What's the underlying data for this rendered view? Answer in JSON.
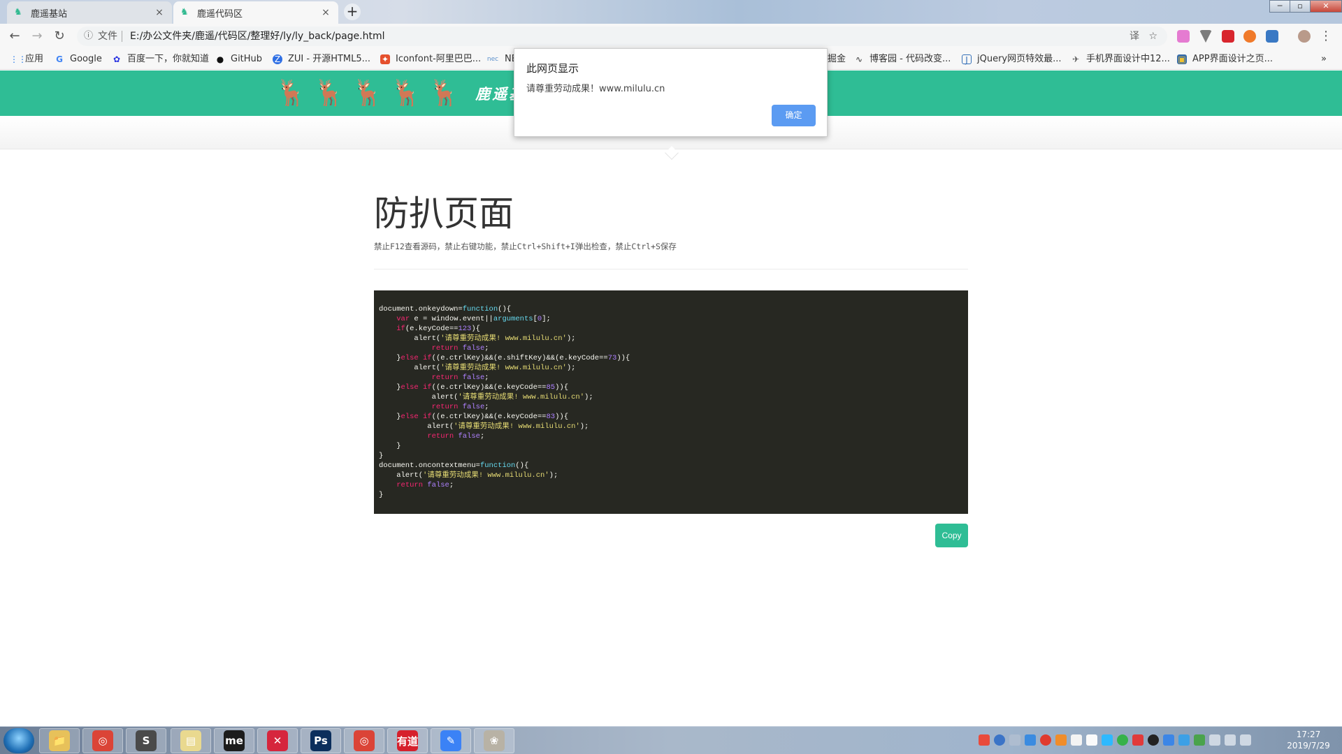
{
  "tabs": [
    {
      "title": "鹿遥基站",
      "close": "×"
    },
    {
      "title": "鹿遥代码区",
      "close": "×"
    }
  ],
  "newtab": "+",
  "window_controls": {
    "minimize": "─",
    "maximize": "▫",
    "close": "✕"
  },
  "toolbar": {
    "back": "←",
    "forward": "→",
    "reload": "↻",
    "info_icon": "ⓘ",
    "scheme": "文件",
    "url": "E:/办公文件夹/鹿遥/代码区/整理好/ly/ly_back/page.html",
    "translate": "译",
    "star": "☆"
  },
  "bookmarks": [
    {
      "label": "应用",
      "icon": "apps-icon",
      "glyph": "⋮⋮"
    },
    {
      "label": "Google",
      "icon": "google-icon",
      "glyph": "G"
    },
    {
      "label": "百度一下，你就知道",
      "icon": "baidu-icon",
      "glyph": "✿"
    },
    {
      "label": "GitHub",
      "icon": "github-icon",
      "glyph": "●"
    },
    {
      "label": "ZUI - 开源HTML5...",
      "icon": "zui-icon",
      "glyph": "Z"
    },
    {
      "label": "Iconfont-阿里巴巴...",
      "icon": "iconfont-icon",
      "glyph": "✦"
    },
    {
      "label": "NE",
      "icon": "nec-icon",
      "glyph": "nec"
    },
    {
      "label": "掘金",
      "icon": "juejin-icon",
      "glyph": ""
    },
    {
      "label": "博客园 - 代码改变...",
      "icon": "cnblogs-icon",
      "glyph": "∿"
    },
    {
      "label": "jQuery网页特效最...",
      "icon": "jquery-icon",
      "glyph": "J"
    },
    {
      "label": "手机界面设计中12...",
      "icon": "plane-icon",
      "glyph": "✈"
    },
    {
      "label": "APP界面设计之页...",
      "icon": "app-icon",
      "glyph": "▣"
    }
  ],
  "bookmarks_more": "»",
  "page": {
    "site_name": "鹿遥基站",
    "deer_glyphs": [
      "🦌",
      "🦌",
      "🦌",
      "🦌",
      "🦌"
    ],
    "subnav_label": "",
    "heading": "防扒页面",
    "description": "禁止F12查看源码，禁止右键功能，禁止Ctrl+Shift+I弹出检查，禁止Ctrl+S保存",
    "code": [
      "document.onkeydown=function(){",
      "    var e = window.event||arguments[0];",
      "    if(e.keyCode==123){",
      "        alert('请尊重劳动成果! www.milulu.cn');",
      "            return false;",
      "    }else if((e.ctrlKey)&&(e.shiftKey)&&(e.keyCode==73)){",
      "        alert('请尊重劳动成果! www.milulu.cn');",
      "            return false;",
      "    }else if((e.ctrlKey)&&(e.keyCode==85)){",
      "            alert('请尊重劳动成果! www.milulu.cn');",
      "            return false;",
      "    }else if((e.ctrlKey)&&(e.keyCode==83)){",
      "           alert('请尊重劳动成果! www.milulu.cn');",
      "           return false;",
      "    }",
      "}",
      "document.oncontextmenu=function(){",
      "    alert('请尊重劳动成果! www.milulu.cn');",
      "    return false;",
      "}"
    ],
    "copy_label": "Copy"
  },
  "dialog": {
    "title": "此网页显示",
    "message": "请尊重劳动成果！www.milulu.cn",
    "ok_label": "确定"
  },
  "taskbar": {
    "apps": [
      {
        "name": "explorer",
        "glyph": "📁",
        "color": "#e7c15a"
      },
      {
        "name": "chrome",
        "glyph": "◎",
        "color": "#db4437"
      },
      {
        "name": "sublime",
        "glyph": "S",
        "color": "#4a4a4a"
      },
      {
        "name": "folder",
        "glyph": "▤",
        "color": "#e9d98f"
      },
      {
        "name": "mindmanager",
        "glyph": "me",
        "color": "#1c1c1c"
      },
      {
        "name": "xmind",
        "glyph": "✕",
        "color": "#d6263d"
      },
      {
        "name": "photoshop",
        "glyph": "Ps",
        "color": "#0b2e5c"
      },
      {
        "name": "chrome-2",
        "glyph": "◎",
        "color": "#db4437"
      },
      {
        "name": "youdao",
        "glyph": "有道",
        "color": "#d6202c"
      },
      {
        "name": "notes",
        "glyph": "✎",
        "color": "#3b82f6"
      },
      {
        "name": "avatar-app",
        "glyph": "❀",
        "color": "#b8b2a5"
      }
    ],
    "time": "17:27",
    "date": "2019/7/29"
  }
}
